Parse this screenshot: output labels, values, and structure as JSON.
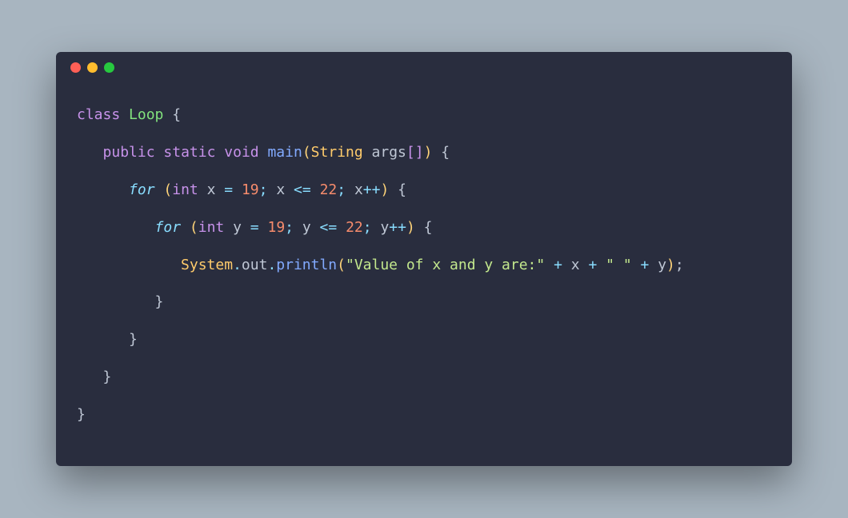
{
  "window": {
    "dots": [
      "red",
      "yellow",
      "green"
    ]
  },
  "code": {
    "line1": {
      "kw": "class",
      "name": "Loop",
      "brace": "{"
    },
    "line2": {
      "mods": [
        "public",
        "static"
      ],
      "ret": "void",
      "fn": "main",
      "argtype": "String",
      "argname": "args",
      "brackets": "[]",
      "brace": "{"
    },
    "line3": {
      "kw": "for",
      "type": "int",
      "var": "x",
      "eq": "=",
      "init": "19",
      "cond_var": "x",
      "cond_op": "<=",
      "cond_val": "22",
      "inc_var": "x",
      "inc_op": "++",
      "brace": "{"
    },
    "line4": {
      "kw": "for",
      "type": "int",
      "var": "y",
      "eq": "=",
      "init": "19",
      "cond_var": "y",
      "cond_op": "<=",
      "cond_val": "22",
      "inc_var": "y",
      "inc_op": "++",
      "brace": "{"
    },
    "line5": {
      "obj": "System",
      "dot1": ".",
      "out": "out",
      "dot2": ".",
      "fn": "println",
      "str": "\"Value of x and y are:\"",
      "plus1": "+",
      "v1": "x",
      "plus2": "+",
      "str2": "\" \"",
      "plus3": "+",
      "v2": "y",
      "semi": ";"
    },
    "line6": {
      "brace": "}"
    },
    "line7": {
      "brace": "}"
    },
    "line8": {
      "brace": "}"
    },
    "line9": {
      "brace": "}"
    }
  }
}
